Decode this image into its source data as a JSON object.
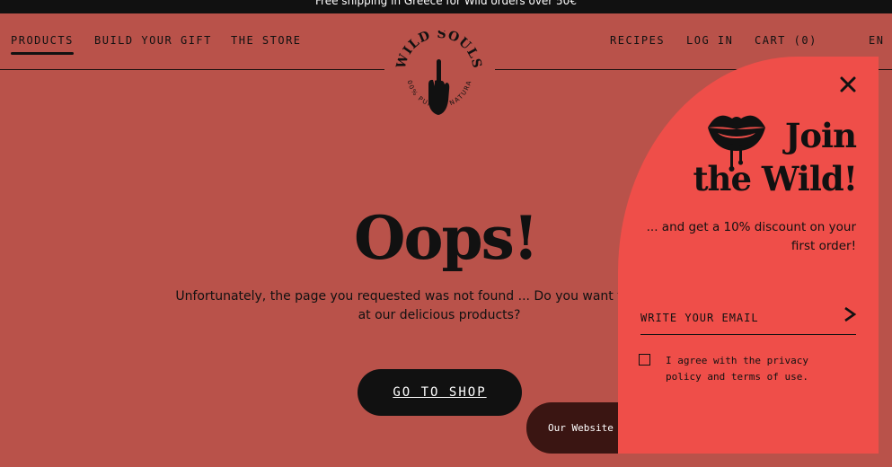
{
  "announcement": "Free shipping in Greece for Wild orders over 50€",
  "nav": {
    "left": [
      "PRODUCTS",
      "BUILD YOUR GIFT",
      "THE STORE"
    ],
    "right": [
      "RECIPES",
      "LOG IN",
      "CART (0)",
      "EN"
    ]
  },
  "logo": {
    "brand": "WILD SOULS",
    "tagline": "100% PURE & NATURAL"
  },
  "error": {
    "title": "Oops!",
    "message": "Unfortunately, the page you requested was not found ... Do you want to take a look at our delicious products?",
    "cta": "GO TO SHOP"
  },
  "cookie_pill": "Our Website",
  "popup": {
    "headline_1": "Join",
    "headline_2": "the Wild!",
    "subtext": "... and get a 10% discount on your first order!",
    "email_placeholder": "WRITE YOUR EMAIL",
    "agree": "I agree with the privacy policy and terms of use.",
    "accent_color": "#ef4e49"
  },
  "colors": {
    "background": "#b9524a",
    "ink": "#111111"
  },
  "icons": [
    "close-icon",
    "lips-icon",
    "arrow-right-icon",
    "hand-icon"
  ]
}
